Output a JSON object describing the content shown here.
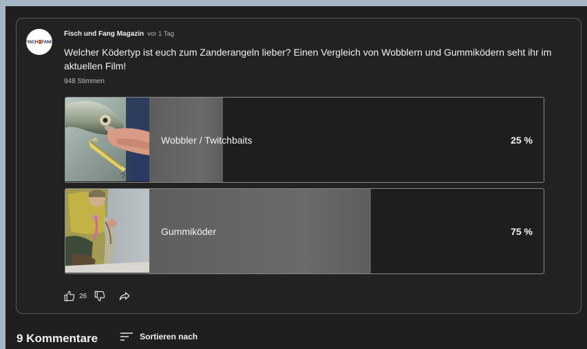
{
  "post": {
    "channel_name": "Fisch und Fang Magazin",
    "time_ago": "vor 1 Tag",
    "avatar_logo": "FISCH FANG",
    "question": "Welcher Ködertyp ist euch zum Zanderangeln lieber? Einen Vergleich von Wobblern und Gummiködern seht ihr im aktuellen Film!",
    "vote_count": "948 Stimmen",
    "options": [
      {
        "label": "Wobbler / Twitchbaits",
        "percent_text": "25 %",
        "percent": 25,
        "thumbnail_icon": "fish-with-wobbler-photo"
      },
      {
        "label": "Gummiköder",
        "percent_text": "75 %",
        "percent": 75,
        "thumbnail_icon": "angler-holding-zander-photo"
      }
    ],
    "actions": {
      "like_icon": "thumbs-up-icon",
      "like_count": "26",
      "dislike_icon": "thumbs-down-icon",
      "share_icon": "share-icon"
    }
  },
  "comments": {
    "count_label": "9 Kommentare",
    "sort_icon": "sort-icon",
    "sort_label": "Sortieren nach"
  },
  "colors": {
    "background": "#1f1f1f",
    "card_border": "#5a5a5a",
    "option_border": "#8a8a8a",
    "result_fill": "#636363",
    "text": "#f1f1f1",
    "outer_frame": "#a6b6c4"
  }
}
